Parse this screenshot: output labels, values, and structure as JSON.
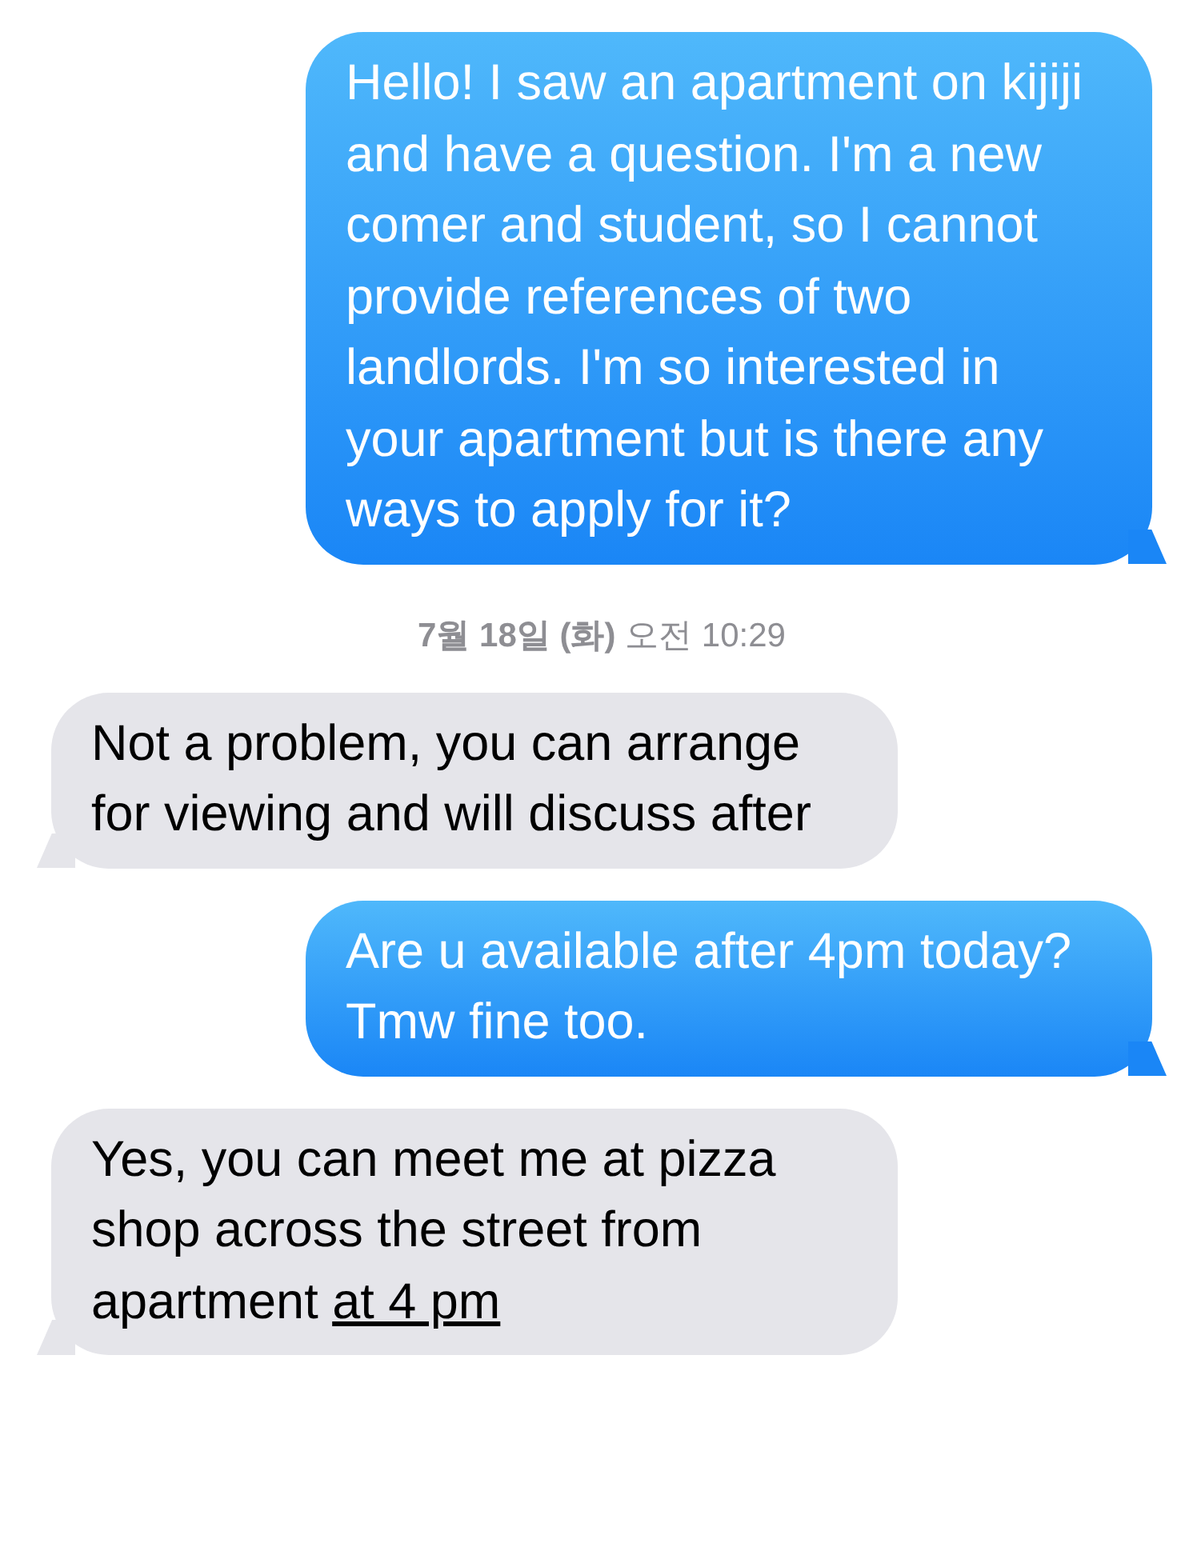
{
  "messages": [
    {
      "kind": "sent",
      "text": "Hello! I saw an apartment on kijiji and have a question. I'm a new comer and student, so I cannot provide references of two landlords. I'm so interested in your apartment but is there any ways to apply for it?"
    },
    {
      "kind": "timestamp",
      "text": "**7월 18일 (화)** 오전 10:29"
    },
    {
      "kind": "received",
      "text": "Not a problem, you can arrange for viewing and will discuss after"
    },
    {
      "kind": "sent",
      "text": "Are u available after 4pm today? Tmw fine too."
    },
    {
      "kind": "received",
      "text": "Yes, you can meet me at pizza shop across the street from apartment",
      "link": "at 4 pm"
    }
  ]
}
